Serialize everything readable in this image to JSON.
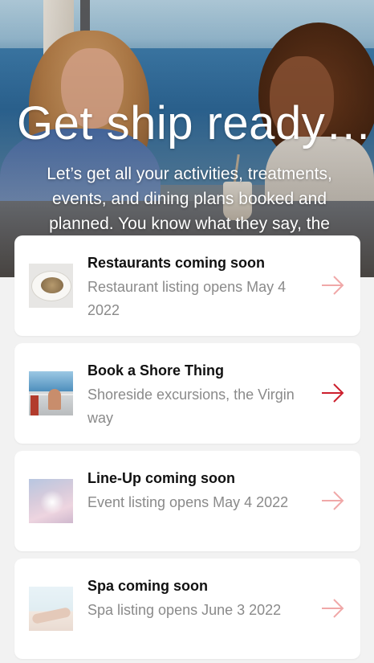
{
  "hero": {
    "title": "Get ship ready…",
    "subtitle": "Let’s get all your activities, treatments, events, and dining plans booked and planned. You know what they say, the"
  },
  "cards": [
    {
      "title": "Restaurants coming soon",
      "subtitle": "Restaurant listing opens May 4 2022",
      "thumb": "restaurant-dish-image",
      "arrow_color": "#f0a8a8",
      "enabled": false
    },
    {
      "title": "Book a Shore Thing",
      "subtitle": "Shoreside excursions, the Virgin way",
      "thumb": "shore-excursion-image",
      "arrow_color": "#cc1f2d",
      "enabled": true
    },
    {
      "title": "Line-Up coming soon",
      "subtitle": "Event listing opens May 4 2022",
      "thumb": "event-lineup-image",
      "arrow_color": "#f0a8a8",
      "enabled": false
    },
    {
      "title": "Spa coming soon",
      "subtitle": "Spa listing opens June 3 2022",
      "thumb": "spa-treatment-image",
      "arrow_color": "#f0a8a8",
      "enabled": false
    }
  ],
  "icons": {
    "arrow": "arrow-right-icon"
  }
}
